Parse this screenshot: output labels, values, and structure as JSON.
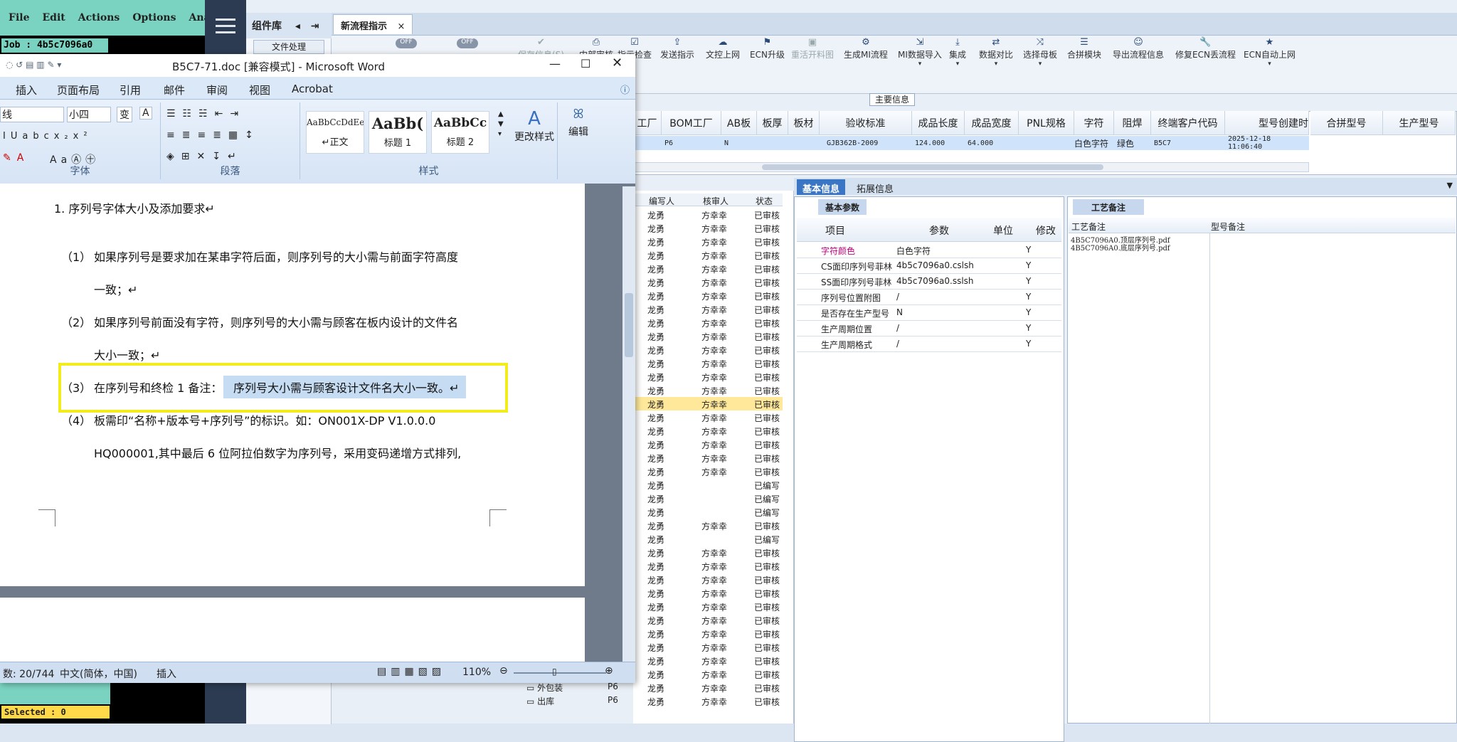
{
  "cam": {
    "menu": [
      "File",
      "Edit",
      "Actions",
      "Options",
      "Analysis"
    ],
    "job": "Job : 4b5c7096a0",
    "selected": "Selected : 0"
  },
  "mes": {
    "library_title": "组件库",
    "library_item": "文件处理",
    "tab": "新流程指示",
    "toggle1": "OFF",
    "toggle2": "OFF",
    "tools": [
      "保存信息(S)",
      "内部审核",
      "指示检查",
      "发送指示",
      "文控上网",
      "ECN升级",
      "重活开料图",
      "生成MI流程",
      "MI数据导入",
      "集成",
      "数据对比",
      "选择母板",
      "合拼模块",
      "导出流程信息",
      "修复ECN丢流程",
      "ECN自动上网"
    ],
    "section_label": "主要信息",
    "grid_headers": [
      "工厂",
      "BOM工厂",
      "AB板",
      "板厚",
      "板材",
      "验收标准",
      "成品长度",
      "成品宽度",
      "PNL规格",
      "字符",
      "阻焊",
      "终端客户代码",
      "型号创建时",
      "合拼型号",
      "生产型号"
    ],
    "grid_row": {
      "factory": "P6",
      "ab": "N",
      "standard": "GJB362B-2009",
      "length": "124.000",
      "width": "64.000",
      "char": "白色字符",
      "mask": "绿色",
      "customer": "B5C7",
      "created": "2025-12-18 11:06:40"
    },
    "list_headers": [
      "编写人",
      "核审人",
      "状态"
    ],
    "list_rows": [
      [
        "龙勇",
        "方幸幸",
        "已审核"
      ],
      [
        "龙勇",
        "方幸幸",
        "已审核"
      ],
      [
        "龙勇",
        "方幸幸",
        "已审核"
      ],
      [
        "龙勇",
        "方幸幸",
        "已审核"
      ],
      [
        "龙勇",
        "方幸幸",
        "已审核"
      ],
      [
        "龙勇",
        "方幸幸",
        "已审核"
      ],
      [
        "龙勇",
        "方幸幸",
        "已审核"
      ],
      [
        "龙勇",
        "方幸幸",
        "已审核"
      ],
      [
        "龙勇",
        "方幸幸",
        "已审核"
      ],
      [
        "龙勇",
        "方幸幸",
        "已审核"
      ],
      [
        "龙勇",
        "方幸幸",
        "已审核"
      ],
      [
        "龙勇",
        "方幸幸",
        "已审核"
      ],
      [
        "龙勇",
        "方幸幸",
        "已审核"
      ],
      [
        "龙勇",
        "方幸幸",
        "已审核"
      ],
      [
        "龙勇",
        "方幸幸",
        "已审核"
      ],
      [
        "龙勇",
        "方幸幸",
        "已审核"
      ],
      [
        "龙勇",
        "方幸幸",
        "已审核"
      ],
      [
        "龙勇",
        "方幸幸",
        "已审核"
      ],
      [
        "龙勇",
        "方幸幸",
        "已审核"
      ],
      [
        "龙勇",
        "方幸幸",
        "已审核"
      ],
      [
        "龙勇",
        "",
        "已编写"
      ],
      [
        "龙勇",
        "",
        "已编写"
      ],
      [
        "龙勇",
        "",
        "已编写"
      ],
      [
        "龙勇",
        "方幸幸",
        "已审核"
      ],
      [
        "龙勇",
        "",
        "已编写"
      ],
      [
        "龙勇",
        "方幸幸",
        "已审核"
      ],
      [
        "龙勇",
        "方幸幸",
        "已审核"
      ],
      [
        "龙勇",
        "方幸幸",
        "已审核"
      ],
      [
        "龙勇",
        "方幸幸",
        "已审核"
      ],
      [
        "龙勇",
        "方幸幸",
        "已审核"
      ],
      [
        "龙勇",
        "方幸幸",
        "已审核"
      ],
      [
        "龙勇",
        "方幸幸",
        "已审核"
      ],
      [
        "龙勇",
        "方幸幸",
        "已审核"
      ],
      [
        "龙勇",
        "方幸幸",
        "已审核"
      ],
      [
        "龙勇",
        "方幸幸",
        "已审核"
      ],
      [
        "龙勇",
        "方幸幸",
        "已审核"
      ],
      [
        "龙勇",
        "方幸幸",
        "已审核"
      ]
    ],
    "tree_items": [
      {
        "name": "外包装",
        "site": "P6"
      },
      {
        "name": "出库",
        "site": "P6"
      }
    ],
    "tabs_basic": [
      "基本信息",
      "拓展信息"
    ],
    "basic_params_tab": "基本参数",
    "param_headers": [
      "项目",
      "参数",
      "单位",
      "修改"
    ],
    "params": [
      [
        "字符颜色",
        "白色字符",
        "",
        "Y"
      ],
      [
        "CS面印序列号菲林",
        "4b5c7096a0.cslsh",
        "",
        "Y"
      ],
      [
        "SS面印序列号菲林",
        "4b5c7096a0.sslsh",
        "",
        "Y"
      ],
      [
        "序列号位置附图",
        "/",
        "",
        "Y"
      ],
      [
        "是否存在生产型号",
        "N",
        "",
        "Y"
      ],
      [
        "生产周期位置",
        "/",
        "",
        "Y"
      ],
      [
        "生产周期格式",
        "/",
        "",
        "Y"
      ]
    ],
    "craft_tab": "工艺备注",
    "craft_headers": [
      "工艺备注",
      "型号备注"
    ],
    "craft_lines": [
      "4B5C7096A0.顶层序列号.pdf",
      "4B5C7096A0.底层序列号.pdf"
    ]
  },
  "word": {
    "title": "B5C7-71.doc [兼容模式] - Microsoft Word",
    "tabs": [
      "插入",
      "页面布局",
      "引用",
      "邮件",
      "审阅",
      "视图",
      "Acrobat"
    ],
    "font_name": "线",
    "font_size": "小四",
    "groups": [
      "字体",
      "段落",
      "样式"
    ],
    "styles": [
      {
        "sample": "AaBbCcDdEe",
        "name": "↵正文"
      },
      {
        "sample": "AaBb(",
        "name": "标题 1"
      },
      {
        "sample": "AaBbCc",
        "name": "标题 2"
      }
    ],
    "more_styles": "更改样式",
    "edit": "编辑",
    "heading": "1.  序列号字体大小及添加要求↵",
    "p1_num": "（1）",
    "p1a": "如果序列号是要求加在某串字符后面，则序列号的大小需与前面字符高度",
    "p1b": "一致；↵",
    "p2_num": "（2）",
    "p2a": "如果序列号前面没有字符，则序列号的大小需与顾客在板内设计的文件名",
    "p2b": "大小一致；↵",
    "p3_num": "（3）",
    "p3a": "在序列号和终检 1 备注：",
    "p3b": "序列号大小需与顾客设计文件名大小一致。↵",
    "p4_num": "（4）",
    "p4a": "板需印“名称+版本号+序列号”的标识。如：ON001X-DP V1.0.0.0",
    "p4b": "HQ000001,其中最后 6 位阿拉伯数字为序列号，采用变码递增方式排列,",
    "status_words": "数: 20/744",
    "status_lang": "中文(简体，中国)",
    "status_mode": "插入",
    "zoom": "110%"
  }
}
